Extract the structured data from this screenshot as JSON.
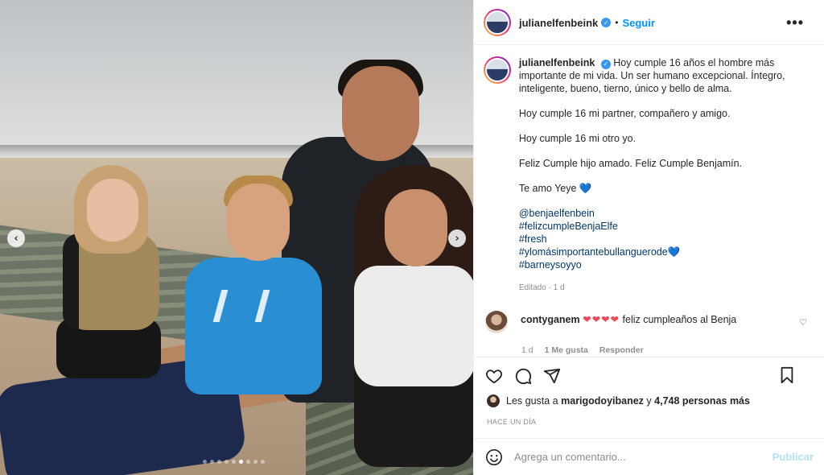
{
  "post": {
    "username": "julianelfenbeink",
    "follow_label": "Seguir",
    "separator": "•",
    "more_icon": "•••",
    "verified_icon": "✓"
  },
  "carousel": {
    "prev_icon": "‹",
    "next_icon": "›",
    "total_slides": 9,
    "active_slide": 6
  },
  "caption": {
    "username": "julianelfenbeink",
    "p1": "Hoy cumple 16 años el hombre más importante de mi vida. Un ser humano excepcional. Íntegro, inteligente, bueno, tierno, único y bello de alma.",
    "p2": "Hoy cumple 16 mi partner, compañero y amigo.",
    "p3": "Hoy cumple 16 mi otro yo.",
    "p4": "Feliz Cumple hijo amado. Feliz Cumple Benjamín.",
    "p5": "Te amo Yeye",
    "heart": "💙",
    "tags": [
      "@benjaelfenbein",
      "#felizcumpleBenjaElfe",
      "#fresh",
      "#ylomásimportantebullanguerode",
      "#barneysoyyo"
    ],
    "last_tag_heart": "💙",
    "edited": "Editado · 1 d"
  },
  "comment": {
    "username": "contyganem",
    "hearts": "❤❤❤❤",
    "text": "feliz cumpleaños al Benja",
    "age": "1 d",
    "likes": "1 Me gusta",
    "reply": "Responder",
    "like_icon": "♡"
  },
  "likes": {
    "prefix": "Les gusta a",
    "user": "marigodoyibanez",
    "joiner": "y",
    "count": "4,748 personas más"
  },
  "timestamp": "HACE UN DÍA",
  "composer": {
    "placeholder": "Agrega un comentario...",
    "publish_label": "Publicar"
  },
  "colors": {
    "accent": "#0095f6",
    "publish_disabled": "#b2dffc",
    "heart_red": "#ed4956",
    "verified": "#3897f0",
    "hashtag": "#00376b"
  }
}
